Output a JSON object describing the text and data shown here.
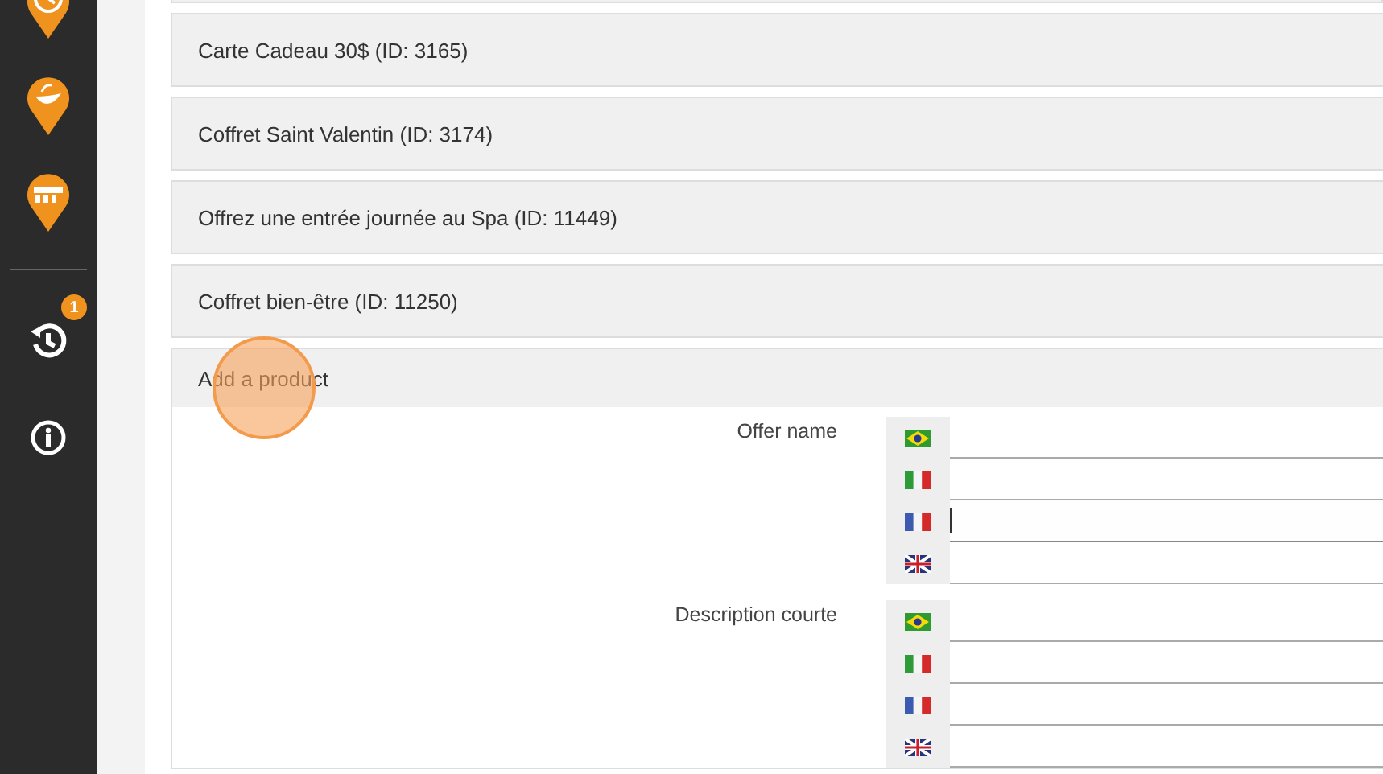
{
  "sidebar": {
    "items": [
      {
        "kind": "clock-pin"
      },
      {
        "kind": "food-pin"
      },
      {
        "kind": "group-pin"
      },
      {
        "kind": "history",
        "badge": "1"
      },
      {
        "kind": "info"
      }
    ]
  },
  "products": [
    {
      "label": "Carte Cadeau 30$ (ID: 3165)"
    },
    {
      "label": "Coffret Saint Valentin (ID: 3174)"
    },
    {
      "label": "Offrez une entrée journée au Spa (ID: 11449)"
    },
    {
      "label": "Coffret bien-être (ID: 11250)"
    }
  ],
  "add_product": {
    "title": "Add a product",
    "fields": [
      {
        "label": "Offer name",
        "inputs": [
          {
            "kind": "br",
            "focused": false
          },
          {
            "kind": "it",
            "focused": false
          },
          {
            "kind": "fr",
            "focused": true
          },
          {
            "kind": "gb",
            "focused": false
          }
        ]
      },
      {
        "label": "Description courte",
        "inputs": [
          {
            "kind": "br",
            "focused": false
          },
          {
            "kind": "it",
            "focused": false
          },
          {
            "kind": "fr",
            "focused": false
          },
          {
            "kind": "gb",
            "focused": false
          }
        ]
      }
    ]
  }
}
